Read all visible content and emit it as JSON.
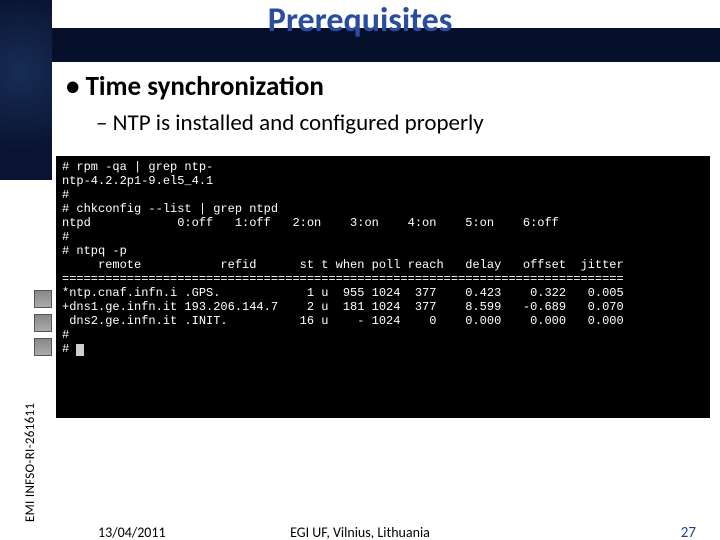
{
  "slide": {
    "title": "Prerequisites",
    "bullet_main": "Time synchronization",
    "bullet_sub": "NTP is installed and configured properly"
  },
  "terminal": {
    "lines": [
      "# rpm -qa | grep ntp-",
      "ntp-4.2.2p1-9.el5_4.1",
      "#",
      "# chkconfig --list | grep ntpd",
      "ntpd            0:off   1:off   2:on    3:on    4:on    5:on    6:off",
      "#",
      "# ntpq -p",
      "     remote           refid      st t when poll reach   delay   offset  jitter",
      "==============================================================================",
      "*ntp.cnaf.infn.i .GPS.            1 u  955 1024  377    0.423    0.322   0.005",
      "+dns1.ge.infn.it 193.206.144.7    2 u  181 1024  377    8.599   -0.689   0.070",
      " dns2.ge.infn.it .INIT.          16 u    - 1024    0    0.000    0.000   0.000",
      "#",
      "# "
    ]
  },
  "side": {
    "label": "EMI INFSO-RI-261611"
  },
  "footer": {
    "date": "13/04/2011",
    "center": "EGI UF, Vilnius, Lithuania",
    "page": "27"
  }
}
